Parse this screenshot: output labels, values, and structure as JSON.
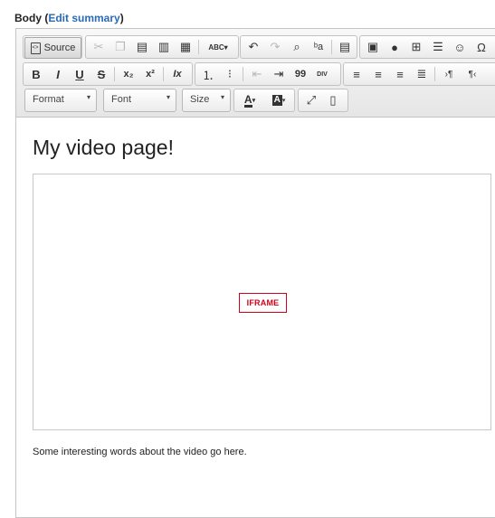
{
  "field": {
    "label": "Body",
    "open_paren": "(",
    "link": "Edit summary",
    "close_paren": ")"
  },
  "toolbar": {
    "source_label": "Source",
    "format_label": "Format",
    "font_label": "Font",
    "size_label": "Size",
    "text_color_letter": "A",
    "bg_color_letter": "A",
    "bold": "B",
    "italic": "I",
    "underline": "U",
    "strike": "S",
    "subscript": "x₂",
    "superscript": "x²",
    "remove_format": "Ix",
    "blockquote": "99",
    "div": "DIV",
    "spellcheck": "ABC",
    "bidi_ltr": "›¶",
    "bidi_rtl": "¶‹",
    "special_char": "Ω"
  },
  "content": {
    "heading": "My video page!",
    "iframe_placeholder": "IFRAME",
    "paragraph": "Some interesting words about the video go here."
  },
  "colors": {
    "link": "#2a6bb5",
    "iframe_marker": "#d0021b"
  }
}
